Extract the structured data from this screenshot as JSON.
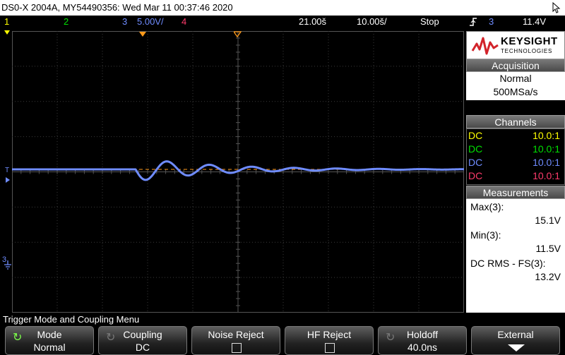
{
  "title_bar": {
    "text": "DS0-X 2004A, MY54490356: Wed Mar 11 00:37:46 2020"
  },
  "status_bar": {
    "ch1": "1",
    "ch2": "2",
    "ch3": "3",
    "ch3_scale": "5.00V/",
    "ch4": "4",
    "time_offset": "21.00š",
    "time_scale": "10.00š/",
    "run_state": "Stop",
    "trigger_source": "3",
    "trigger_level": "11.4V"
  },
  "colors": {
    "ch1": "#ffff00",
    "ch2": "#00e000",
    "ch3": "#6f8cff",
    "ch4": "#ff3b6b",
    "trigger_marker": "#ff9a1a"
  },
  "logo": {
    "brand": "KEYSIGHT",
    "sub": "TECHNOLOGIES"
  },
  "acquisition": {
    "heading": "Acquisition",
    "mode": "Normal",
    "rate": "500MSa/s"
  },
  "channels": {
    "heading": "Channels",
    "rows": [
      {
        "coupling": "DC",
        "probe": "10.0:1"
      },
      {
        "coupling": "DC",
        "probe": "10.0:1"
      },
      {
        "coupling": "DC",
        "probe": "10.0:1"
      },
      {
        "coupling": "DC",
        "probe": "10.0:1"
      }
    ]
  },
  "measurements": {
    "heading": "Measurements",
    "items": [
      {
        "label": "Max(3):",
        "value": "15.1V"
      },
      {
        "label": "Min(3):",
        "value": "11.5V"
      },
      {
        "label": "DC RMS - FS(3):",
        "value": "13.2V"
      }
    ]
  },
  "menu": {
    "title": "Trigger Mode and Coupling Menu",
    "softkeys": [
      {
        "label": "Mode",
        "value": "Normal"
      },
      {
        "label": "Coupling",
        "value": "DC"
      },
      {
        "label": "Noise Reject",
        "value": ""
      },
      {
        "label": "HF Reject",
        "value": ""
      },
      {
        "label": "Holdoff",
        "value": "40.0ns"
      },
      {
        "label": "External",
        "value": ""
      }
    ]
  },
  "markers": {
    "trigger_level_label": "T",
    "ground_ref_label": "3"
  }
}
